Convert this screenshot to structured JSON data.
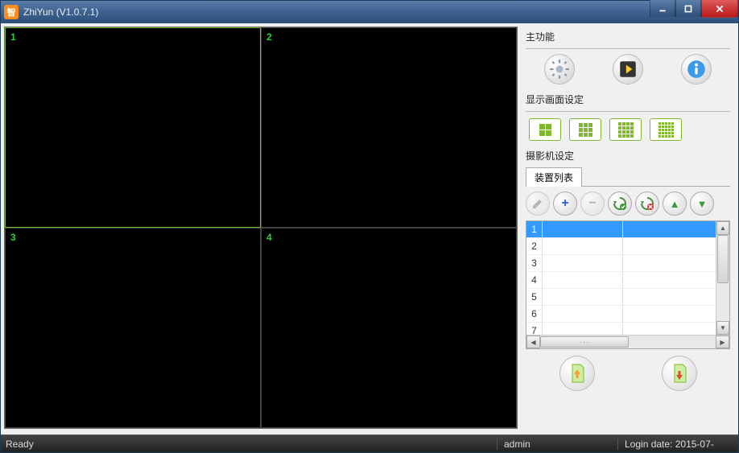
{
  "window": {
    "title": "ZhiYun (V1.0.7.1)",
    "icon_label": "智"
  },
  "video": {
    "cell_labels": [
      "1",
      "2",
      "3",
      "4"
    ],
    "selected_index": 0
  },
  "sidebar": {
    "main_title": "主功能",
    "main_icons": {
      "settings": "settings",
      "play": "play",
      "info": "info"
    },
    "display_title": "显示画面设定",
    "grid_options": [
      "2x2",
      "3x3",
      "4x4",
      "5x5"
    ],
    "camera_title": "摄影机设定",
    "tab_device_list": "装置列表",
    "toolbar": {
      "edit": "edit",
      "add": "+",
      "remove": "−",
      "refresh_ok": "refresh-ok",
      "refresh_err": "refresh-err",
      "up": "▲",
      "down": "▼"
    },
    "table": {
      "row_headers": [
        "1",
        "2",
        "3",
        "4",
        "5",
        "6",
        "7"
      ],
      "selected_row": 0
    },
    "bottom": {
      "export_up": "export",
      "import_down": "import"
    }
  },
  "status": {
    "left": "Ready",
    "mid": "admin",
    "right": "Login date: 2015-07-"
  }
}
